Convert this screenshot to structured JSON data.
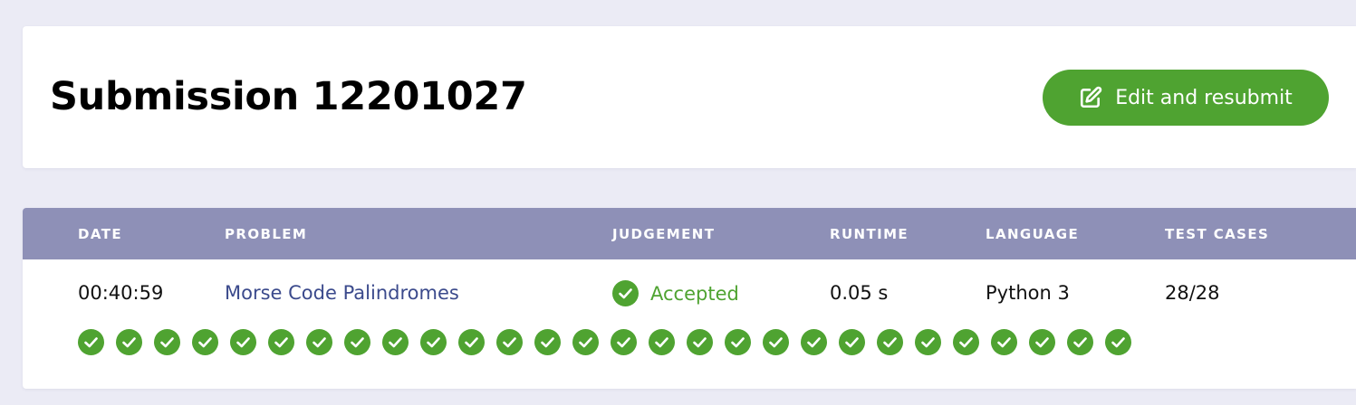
{
  "header": {
    "title": "Submission 12201027",
    "edit_button_label": "Edit and resubmit",
    "edit_icon": "edit-icon"
  },
  "table": {
    "columns": [
      "DATE",
      "PROBLEM",
      "JUDGEMENT",
      "RUNTIME",
      "LANGUAGE",
      "TEST CASES"
    ],
    "row": {
      "date": "00:40:59",
      "problem": "Morse Code Palindromes",
      "judgement": "Accepted",
      "runtime": "0.05 s",
      "language": "Python 3",
      "test_cases": "28/28"
    },
    "test_case_count": 28,
    "test_case_status": "passed",
    "test_case_icon": "check-circle-icon"
  },
  "colors": {
    "accent_green": "#4fa331",
    "table_header": "#8e90b7",
    "link": "#3b4a8c",
    "page_background": "#ebebf5"
  }
}
